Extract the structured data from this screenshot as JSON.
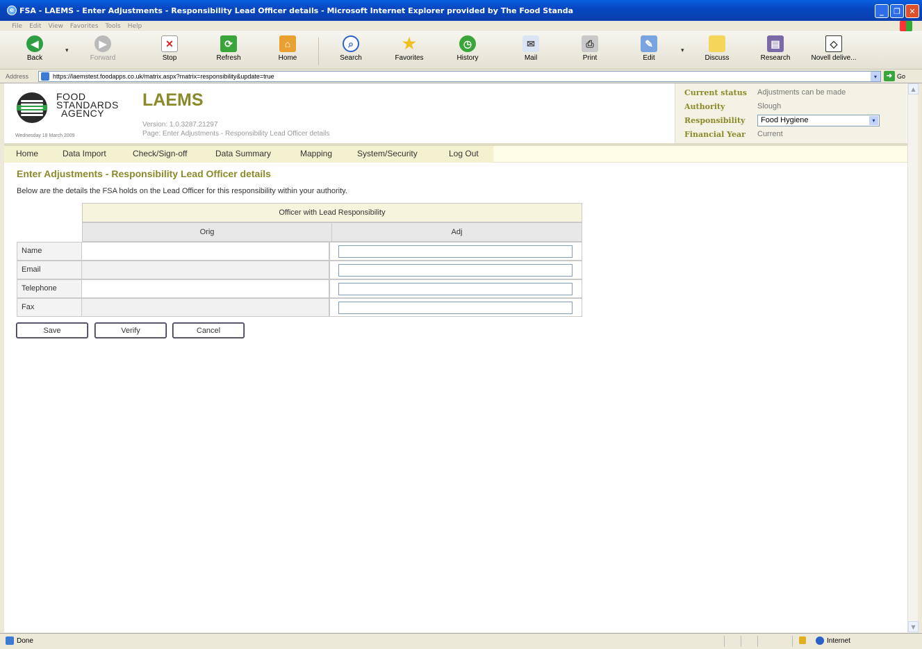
{
  "window": {
    "title": "FSA - LAEMS - Enter Adjustments - Responsibility Lead Officer details - Microsoft Internet Explorer provided by The Food Standa"
  },
  "menu": [
    "File",
    "Edit",
    "View",
    "Favorites",
    "Tools",
    "Help"
  ],
  "toolbar": {
    "back": "Back",
    "forward": "Forward",
    "stop": "Stop",
    "refresh": "Refresh",
    "home": "Home",
    "search": "Search",
    "favorites": "Favorites",
    "history": "History",
    "mail": "Mail",
    "print": "Print",
    "edit": "Edit",
    "discuss": "Discuss",
    "research": "Research",
    "novell": "Novell delive..."
  },
  "address": {
    "label": "Address",
    "url": "https://laemstest.foodapps.co.uk/matrix.aspx?matrix=responsibility&update=true",
    "go": "Go"
  },
  "header": {
    "org_line1": "FOOD",
    "org_line2": "STANDARDS",
    "org_line3": "AGENCY",
    "date": "Wednesday 18 March 2009",
    "app_title": "LAEMS",
    "version": "Version: 1.0.3287.21297",
    "page": "Page: Enter Adjustments - Responsibility Lead Officer details"
  },
  "status": {
    "current_status_label": "Current status",
    "current_status": "Adjustments can be made",
    "authority_label": "Authority",
    "authority": "Slough",
    "responsibility_label": "Responsibility",
    "responsibility": "Food Hygiene",
    "financial_year_label": "Financial Year",
    "financial_year": "Current"
  },
  "nav": [
    "Home",
    "Data Import",
    "Check/Sign-off",
    "Data Summary",
    "Mapping",
    "System/Security",
    "Log Out"
  ],
  "main": {
    "heading": "Enter Adjustments - Responsibility Lead Officer details",
    "description": "Below are the details the FSA holds on the Lead Officer for this responsibility within your authority."
  },
  "table": {
    "group_header": "Officer with Lead Responsibility",
    "orig_header": "Orig",
    "adj_header": "Adj",
    "rows": [
      {
        "label": "Name",
        "orig": "",
        "adj": ""
      },
      {
        "label": "Email",
        "orig": "",
        "adj": ""
      },
      {
        "label": "Telephone",
        "orig": "",
        "adj": ""
      },
      {
        "label": "Fax",
        "orig": "",
        "adj": ""
      }
    ]
  },
  "buttons": {
    "save": "Save",
    "verify": "Verify",
    "cancel": "Cancel"
  },
  "statusbar": {
    "done": "Done",
    "zone": "Internet"
  }
}
